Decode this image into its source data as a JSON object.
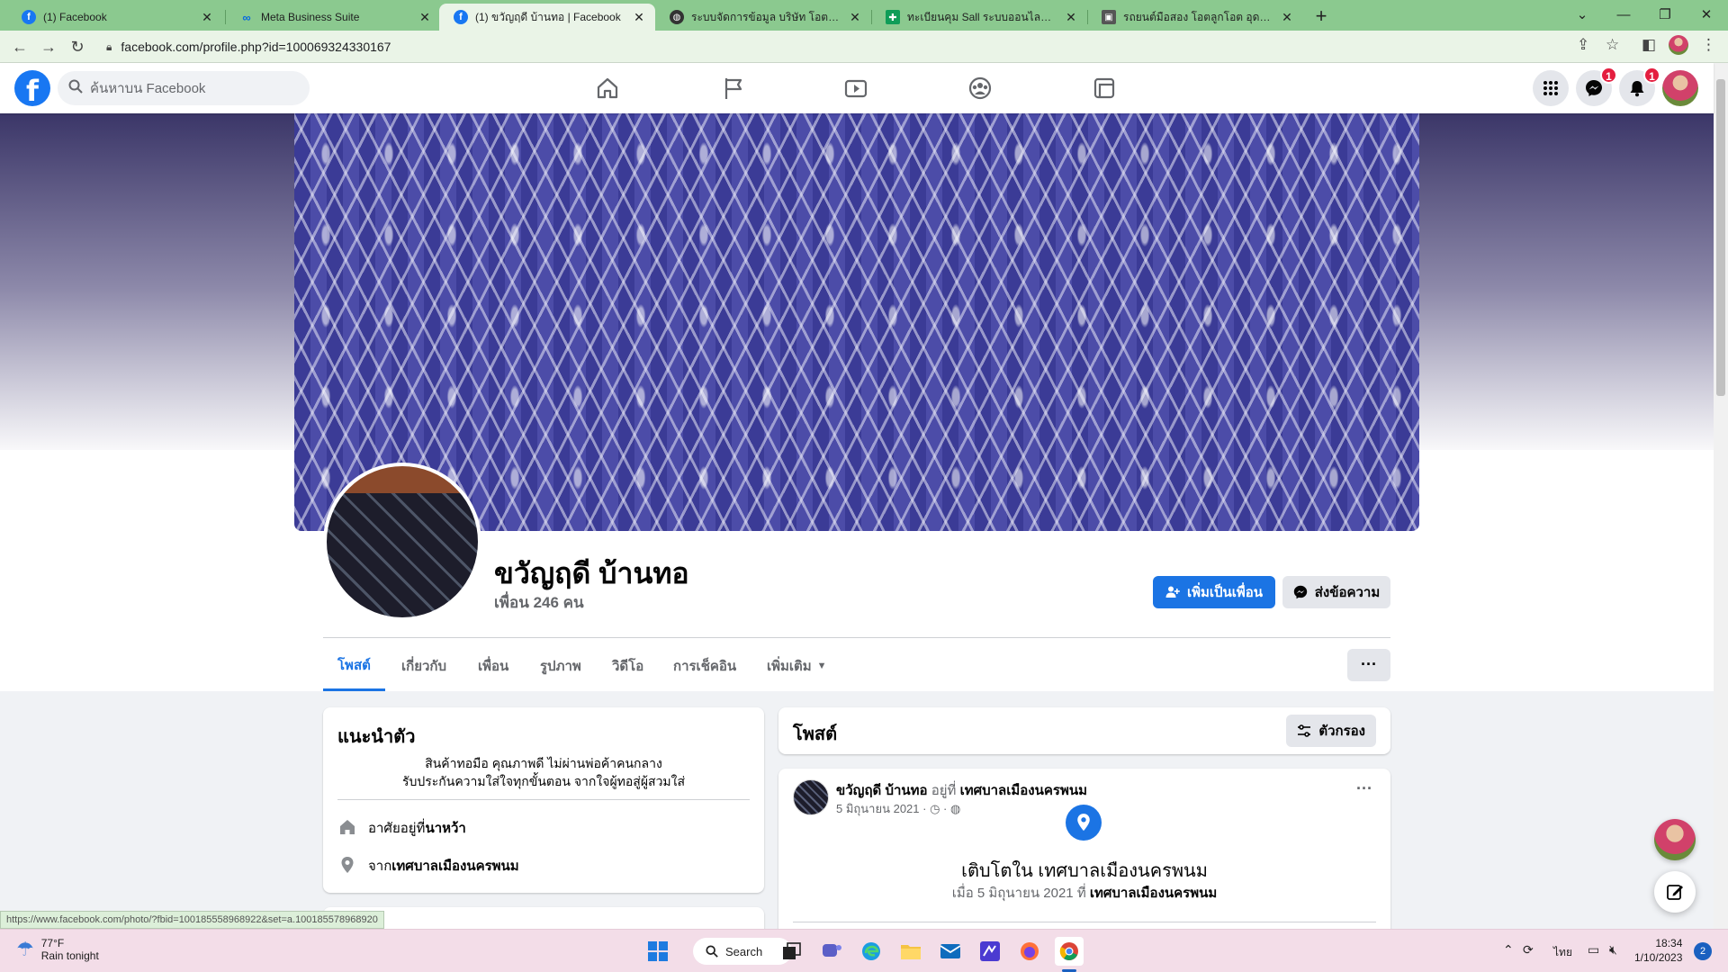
{
  "browser": {
    "tabs": [
      {
        "title": "(1) Facebook",
        "favicon": "facebook-icon"
      },
      {
        "title": "Meta Business Suite",
        "favicon": "meta-icon"
      },
      {
        "title": "(1) ขวัญฤดี บ้านทอ | Facebook",
        "favicon": "facebook-icon",
        "active": true
      },
      {
        "title": "ระบบจัดการข้อมูล บริษัท โอตลูกโอต",
        "favicon": "globe-icon"
      },
      {
        "title": "ทะเบียนคุม Sall ระบบออนไลน์.xlsx - G",
        "favicon": "sheets-icon"
      },
      {
        "title": "รถยนต์มือสอง โอตลูกโอต อุดรธานี",
        "favicon": "site-icon"
      }
    ],
    "url": "facebook.com/profile.php?id=100069324330167",
    "status_url": "https://www.facebook.com/photo/?fbid=100185558968922&set=a.100185578968920"
  },
  "facebook": {
    "search_placeholder": "ค้นหาบน Facebook",
    "messenger_badge": "1",
    "notifications_badge": "1",
    "colors": {
      "brand": "#1877f2",
      "badge": "#e41e3f"
    }
  },
  "profile": {
    "name": "ขวัญฤดี บ้านทอ",
    "friends": "เพื่อน 246 คน",
    "add_friend_label": "เพิ่มเป็นเพื่อน",
    "message_label": "ส่งข้อความ",
    "tabs": [
      "โพสต์",
      "เกี่ยวกับ",
      "เพื่อน",
      "รูปภาพ",
      "วิดีโอ",
      "การเช็คอิน",
      "เพิ่มเติม"
    ],
    "more_label": "···"
  },
  "intro": {
    "title": "แนะนำตัว",
    "bio_line1": "สินค้าทอมือ คุณภาพดี ไม่ผ่านพ่อค้าคนกลาง",
    "bio_line2": "รับประกันความใส่ใจทุกขั้นตอน จากใจผู้ทอสู่ผู้สวมใส่",
    "lives_prefix": "อาศัยอยู่ที่ ",
    "lives_value": "นาหว้า",
    "from_prefix": "จาก ",
    "from_value": "เทศบาลเมืองนครพนม"
  },
  "posts": {
    "title": "โพสต์",
    "filter_label": "ตัวกรอง",
    "post": {
      "author": "ขวัญฤดี บ้านทอ",
      "at_text": " อยู่ที่ ",
      "place": "เทศบาลเมืองนครพนม",
      "date": "5 มิถุนายน 2021 ·",
      "life_event": "เติบโตใน เทศบาลเมืองนครพนม",
      "life_sub_prefix": "เมื่อ 5 มิถุนายน 2021 ที่ ",
      "life_sub_place": "เทศบาลเมืองนครพนม"
    }
  },
  "taskbar": {
    "temp": "77°F",
    "weather": "Rain tonight",
    "search_label": "Search",
    "lang": "ไทย",
    "time": "18:34",
    "date": "1/10/2023",
    "notification_count": "2"
  }
}
